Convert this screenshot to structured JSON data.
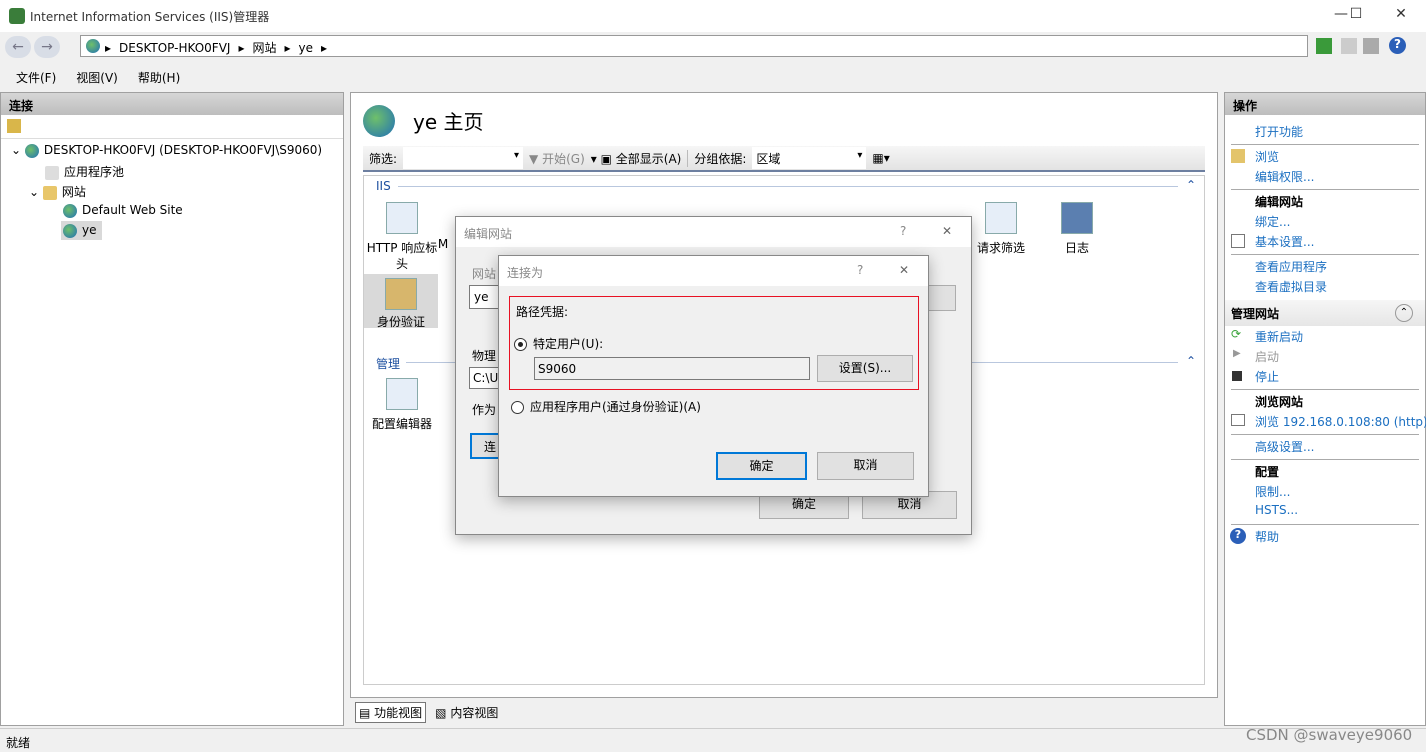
{
  "window": {
    "title": "Internet Information Services (IIS)管理器",
    "min": "—",
    "max": "☐",
    "close": "✕"
  },
  "address": {
    "crumbs": [
      "DESKTOP-HKO0FVJ",
      "网站",
      "ye"
    ]
  },
  "menu": [
    "文件(F)",
    "视图(V)",
    "帮助(H)"
  ],
  "connections": {
    "title": "连接",
    "tree": [
      "DESKTOP-HKO0FVJ (DESKTOP-HKO0FVJ\\S9060)",
      "应用程序池",
      "网站",
      "Default Web Site",
      "ye"
    ]
  },
  "main": {
    "title": "ye 主页",
    "filter_label": "筛选:",
    "filter_value": "",
    "start": "开始(G)",
    "show_all": "全部显示(A)",
    "group_label": "分组依据:",
    "group_value": "区域",
    "sections": {
      "iis": "IIS",
      "manage": "管理"
    },
    "features": [
      "HTTP 响应标头",
      "M",
      "身份验证",
      "请求筛选",
      "日志",
      "配置编辑器"
    ],
    "tabs": [
      "功能视图",
      "内容视图"
    ]
  },
  "edit_site": {
    "title": "编辑网站",
    "help": "?",
    "close": "✕",
    "site_label": "网站",
    "site_value": "ye",
    "phys_label": "物理",
    "phys_value": "C:\\U",
    "as_label": "作为",
    "connect_btn": "连",
    "ok": "确定",
    "cancel": "取消"
  },
  "connect_as": {
    "title": "连接为",
    "help": "?",
    "close": "✕",
    "group": "路径凭据:",
    "specific": "特定用户(U):",
    "user": "S9060",
    "set": "设置(S)...",
    "app_user": "应用程序用户(通过身份验证)(A)",
    "ok": "确定",
    "cancel": "取消",
    "specific_selected": true
  },
  "actions": {
    "title": "操作",
    "items": [
      "打开功能",
      "浏览",
      "编辑权限...",
      "编辑网站",
      "绑定...",
      "基本设置...",
      "查看应用程序",
      "查看虚拟目录",
      "管理网站",
      "重新启动",
      "启动",
      "停止",
      "浏览网站",
      "浏览 192.168.0.108:80 (http)",
      "高级设置...",
      "配置",
      "限制...",
      "HSTS...",
      "帮助"
    ]
  },
  "status": {
    "text": "就绪",
    "watermark": "CSDN @swaveye9060"
  },
  "colors": {
    "link": "#1b6fc1",
    "highlight": "#e81123",
    "accent": "#0078d7"
  }
}
